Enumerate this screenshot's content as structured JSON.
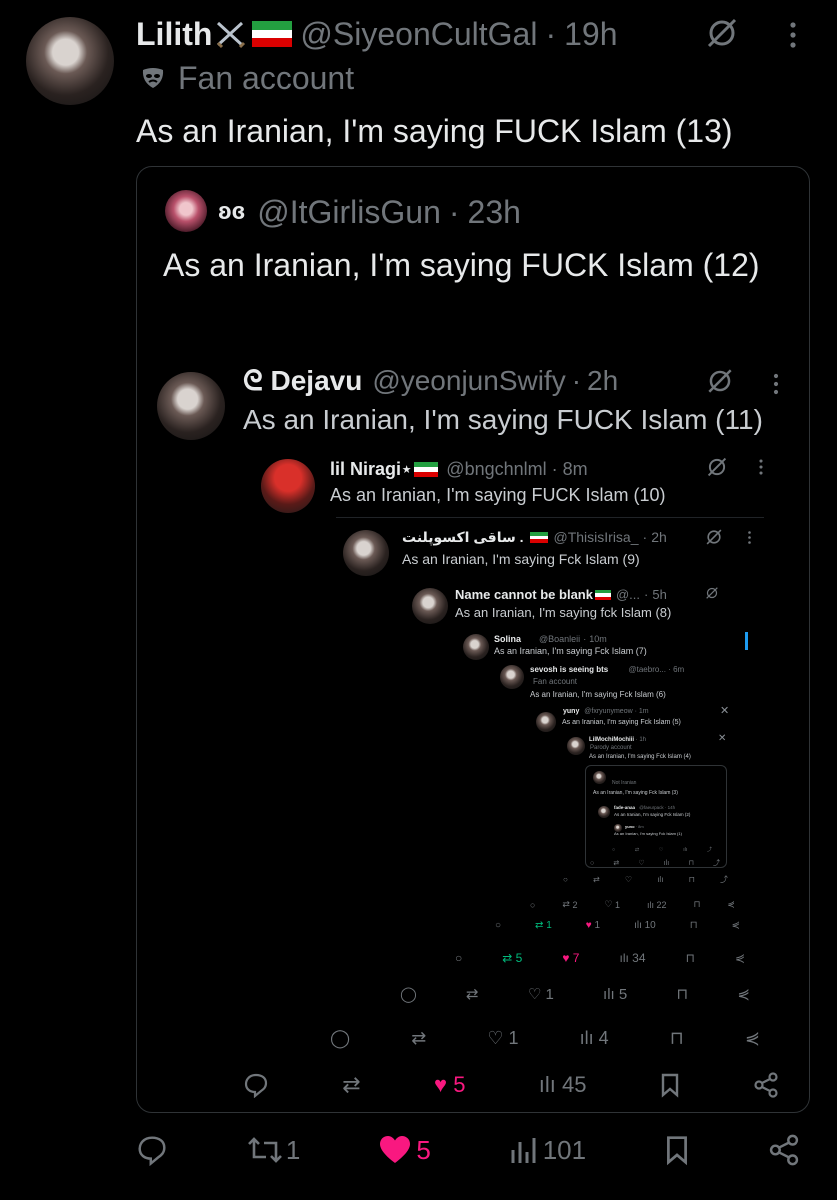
{
  "tweet": {
    "display_name": "Lilith",
    "handle": "@SiyeonCultGal",
    "time": "19h",
    "label": "Fan account",
    "text": "As an Iranian, I'm saying FUCK Islam (13)",
    "actions": {
      "replies": "",
      "reposts": "1",
      "likes": "5",
      "views": "101"
    }
  },
  "quote": {
    "display_name": "ʚɞ",
    "handle": "@ItGirlisGun",
    "time": "23h",
    "text": "As an Iranian, I'm saying FUCK Islam (12)",
    "actions": {
      "likes": "5",
      "views": "45"
    }
  },
  "nested": [
    {
      "display_name": "ᘓ Dejavu",
      "handle": "@yeonjunSwify",
      "time": "2h",
      "text": "As an Iranian, I'm saying FUCK Islam (11)",
      "likes": "1",
      "views": "4"
    },
    {
      "display_name": "lil Niragi⋆",
      "handle": "@bngchnlml",
      "time": "8m",
      "text": "As an Iranian, I'm saying FUCK Islam (10)",
      "likes": "1",
      "views": "5"
    },
    {
      "display_name": "ساقی اکسوپلنت .",
      "handle": "@ThisisIrisa_",
      "time": "2h",
      "text": "As an Iranian, I'm saying Fck Islam (9)",
      "reposts": "5",
      "likes": "7",
      "views": "34"
    },
    {
      "display_name": "Name cannot be blank",
      "handle": "@...",
      "time": "5h",
      "text": "As an Iranian, I'm saying fck Islam (8)",
      "reposts": "1",
      "likes": "1",
      "views": "10"
    },
    {
      "display_name": "Solina",
      "handle": "@Boanleii",
      "time": "10m",
      "text": "As an Iranian, I'm saying Fck Islam (7)",
      "reposts": "2",
      "likes": "1",
      "views": "22"
    },
    {
      "display_name": "sevosh is seeing bts",
      "handle": "@taebro...",
      "time": "6m",
      "label": "Fan account",
      "text": "As an Iranian, I'm saying Fck Islam (6)"
    },
    {
      "display_name": "yuny",
      "handle": "@fxryunymeow",
      "time": "1m",
      "text": "As an Iranian, I'm saying Fck Islam (5)"
    },
    {
      "display_name": "LilMochiMochiii",
      "handle": "",
      "time": "1h",
      "label": "Parody account",
      "text": "As an Iranian, I'm saying Fck Islam (4)"
    },
    {
      "display_name": "",
      "handle": "",
      "time": "",
      "label": "Not Iranian",
      "text": "As an Iranian, I'm saying Fck Islam (3)"
    },
    {
      "display_name": "fade-anaa",
      "handle": "@faeurpack",
      "time": "14h",
      "text": "As an Iranian, I'm saying Fck Islam (2)"
    },
    {
      "display_name": "yuno",
      "handle": "",
      "time": "8m",
      "text": "As an Iranian, I'm saying Fck Islam (1)"
    }
  ],
  "colors": {
    "background": "#000000",
    "muted": "#71767b",
    "like": "#f91880",
    "repost": "#00ba7c",
    "border": "#2f3336"
  }
}
